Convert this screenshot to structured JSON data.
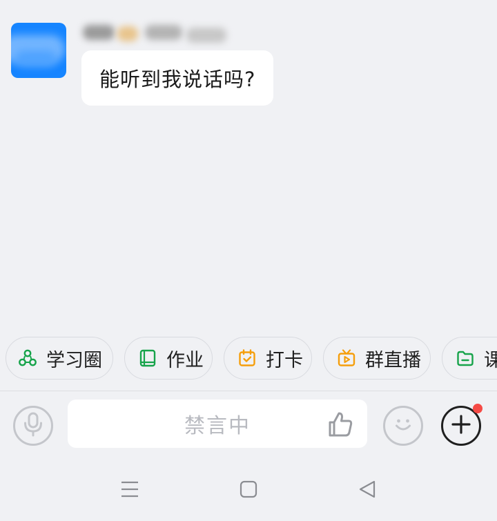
{
  "message": {
    "sender_name": "用户",
    "text": "能听到我说话吗?"
  },
  "quick_actions": [
    {
      "label": "学习圈",
      "icon": "circle-group-icon",
      "color": "#16a34a"
    },
    {
      "label": "作业",
      "icon": "book-icon",
      "color": "#16a34a"
    },
    {
      "label": "打卡",
      "icon": "calendar-check-icon",
      "color": "#f59e0b"
    },
    {
      "label": "群直播",
      "icon": "tv-play-icon",
      "color": "#f59e0b"
    },
    {
      "label": "课",
      "icon": "folder-icon",
      "color": "#16a34a"
    }
  ],
  "input_bar": {
    "placeholder": "禁言中",
    "mic_icon": "mic-icon",
    "like_icon": "thumbs-up-icon",
    "emoji_icon": "smiley-icon",
    "plus_icon": "plus-icon",
    "has_notification_dot": true
  },
  "nav": {
    "menu_icon": "menu-icon",
    "home_icon": "square-home-icon",
    "back_icon": "triangle-back-icon"
  },
  "colors": {
    "background": "#f0f1f4",
    "avatar": "#1685ff",
    "notification": "#f54a45"
  }
}
